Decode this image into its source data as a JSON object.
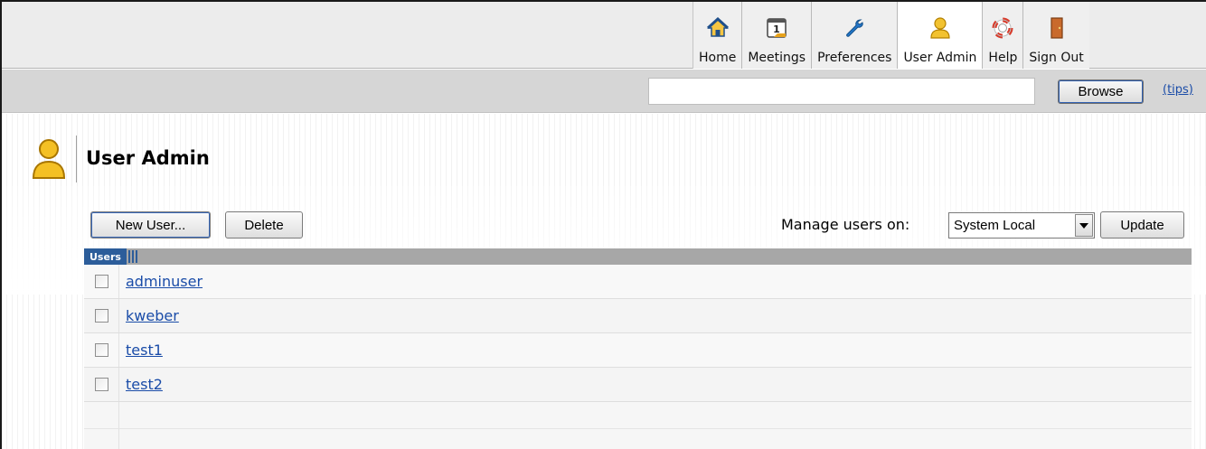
{
  "nav": {
    "items": [
      {
        "label": "Home",
        "icon": "home-icon"
      },
      {
        "label": "Meetings",
        "icon": "calendar-icon"
      },
      {
        "label": "Preferences",
        "icon": "wrench-icon"
      },
      {
        "label": "User Admin",
        "icon": "user-icon",
        "active": true
      },
      {
        "label": "Help",
        "icon": "lifebuoy-icon"
      },
      {
        "label": "Sign Out",
        "icon": "door-icon"
      }
    ]
  },
  "search": {
    "value": "",
    "browse_label": "Browse",
    "tips_label": "(tips)"
  },
  "page": {
    "title": "User Admin",
    "icon": "user-icon"
  },
  "toolbar": {
    "new_user_label": "New User...",
    "delete_label": "Delete",
    "manage_label": "Manage users on:",
    "manage_value": "System Local",
    "update_label": "Update"
  },
  "table": {
    "header": "Users",
    "rows": [
      {
        "name": "adminuser",
        "checked": false
      },
      {
        "name": "kweber",
        "checked": false
      },
      {
        "name": "test1",
        "checked": false
      },
      {
        "name": "test2",
        "checked": false
      }
    ]
  },
  "colors": {
    "link": "#1a4ca8",
    "header_accent": "#2c5d9a",
    "icon_gold": "#f0b400",
    "help_red": "#d83a2a"
  }
}
